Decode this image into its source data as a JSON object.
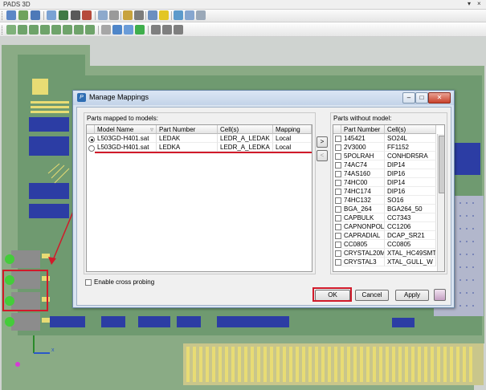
{
  "app": {
    "title": "PADS 3D",
    "window_controls": [
      "▾",
      "×"
    ]
  },
  "toolbar1": {
    "icons": [
      "open-icon",
      "save-icon",
      "copy-icon",
      "paste-icon",
      "print-icon",
      "library-icon",
      "export-icon",
      "zoom-icon",
      "select-icon",
      "measure-icon",
      "tools-icon",
      "warning-icon",
      "properties-icon",
      "help-icon",
      "window-icon"
    ]
  },
  "toolbar2": {
    "icons": [
      "view-iso-icon",
      "view-top-icon",
      "view-bottom-icon",
      "view-front-icon",
      "view-back-icon",
      "view-left-icon",
      "view-right-icon",
      "fit-icon",
      "pan-icon",
      "rotate-icon",
      "zoom-window-icon",
      "refresh-icon",
      "snap-icon",
      "align-icon",
      "flip-icon"
    ]
  },
  "colors": {
    "board": "#6f9a70",
    "pad": "#e8dc74",
    "trace": "#2c3da4",
    "grid_bg": "#b2b7cc",
    "highlight": "#d11a2a",
    "led": "#44cc3a"
  },
  "dialog": {
    "title": "Manage Mappings",
    "buttons": {
      "min": "‒",
      "max": "□",
      "close": "✕"
    },
    "left_group": {
      "label": "Parts mapped to models:",
      "columns": [
        "Model Name",
        "Part Number",
        "Cell(s)",
        "Mapping"
      ],
      "rows": [
        {
          "selected": true,
          "model": "L503GD-H401.sat",
          "part": "LEDAK",
          "cells": "LEDR_A_LEDAK",
          "mapping": "Local"
        },
        {
          "selected": false,
          "model": "L503GD-H401.sat",
          "part": "LEDKA",
          "cells": "LEDR_A_LEDKA",
          "mapping": "Local"
        }
      ]
    },
    "arrows": {
      "right": ">",
      "left": "<"
    },
    "right_group": {
      "label": "Parts without model:",
      "columns": [
        "Part Number",
        "Cell(s)"
      ],
      "rows": [
        {
          "part": "145421",
          "cells": "SO24L"
        },
        {
          "part": "2V3000",
          "cells": "FF1152"
        },
        {
          "part": "5POLRAH",
          "cells": "CONHDR5RA"
        },
        {
          "part": "74AC74",
          "cells": "DIP14"
        },
        {
          "part": "74AS160",
          "cells": "DIP16"
        },
        {
          "part": "74HC00",
          "cells": "DIP14"
        },
        {
          "part": "74HC174",
          "cells": "DIP16"
        },
        {
          "part": "74HC132",
          "cells": "SO16"
        },
        {
          "part": "BGA_264",
          "cells": "BGA264_50"
        },
        {
          "part": "CAPBULK",
          "cells": "CC7343"
        },
        {
          "part": "CAPNONPOL",
          "cells": "CC1206"
        },
        {
          "part": "CAPRADIAL",
          "cells": "DCAP_SR21"
        },
        {
          "part": "CC0805",
          "cells": "CC0805"
        },
        {
          "part": "CRYSTAL20M...",
          "cells": "XTAL_HC49SMT"
        },
        {
          "part": "CRYSTAL3",
          "cells": "XTAL_GULL_W"
        }
      ]
    },
    "cross_probe_label": "Enable cross probing",
    "ok_label": "OK",
    "cancel_label": "Cancel",
    "apply_label": "Apply"
  }
}
